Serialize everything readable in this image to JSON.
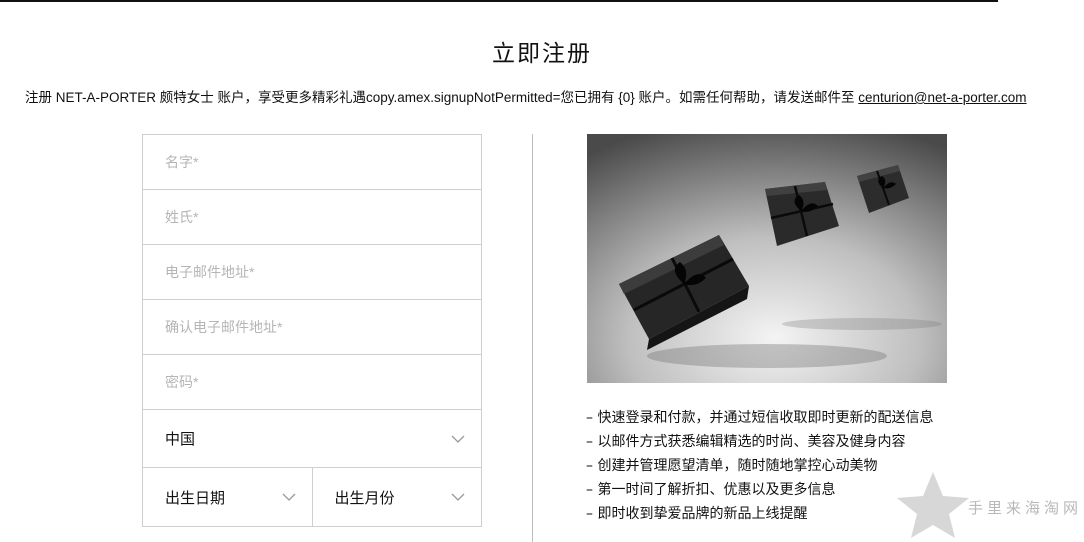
{
  "page": {
    "title": "立即注册",
    "intro_text": "注册 NET-A-PORTER 颇特女士 账户，享受更多精彩礼遇copy.amex.signupNotPermitted=您已拥有 {0} 账户。如需任何帮助，请发送邮件至 ",
    "intro_email": "centurion@net-a-porter.com"
  },
  "form": {
    "first_name_placeholder": "名字*",
    "last_name_placeholder": "姓氏*",
    "email_placeholder": "电子邮件地址*",
    "confirm_email_placeholder": "确认电子邮件地址*",
    "password_placeholder": "密码*",
    "country_value": "中国",
    "birth_day_value": "出生日期",
    "birth_month_value": "出生月份"
  },
  "benefits": [
    "快速登录和付款，并通过短信收取即时更新的配送信息",
    "以邮件方式获悉编辑精选的时尚、美容及健身内容",
    "创建并管理愿望清单，随时随地掌控心动美物",
    "第一时间了解折扣、优惠以及更多信息",
    "即时收到挚爱品牌的新品上线提醒"
  ],
  "watermark": "手里来海淘网",
  "icons": {
    "dropdown": "chevron-down-icon",
    "watermark_logo": "star-icon"
  }
}
